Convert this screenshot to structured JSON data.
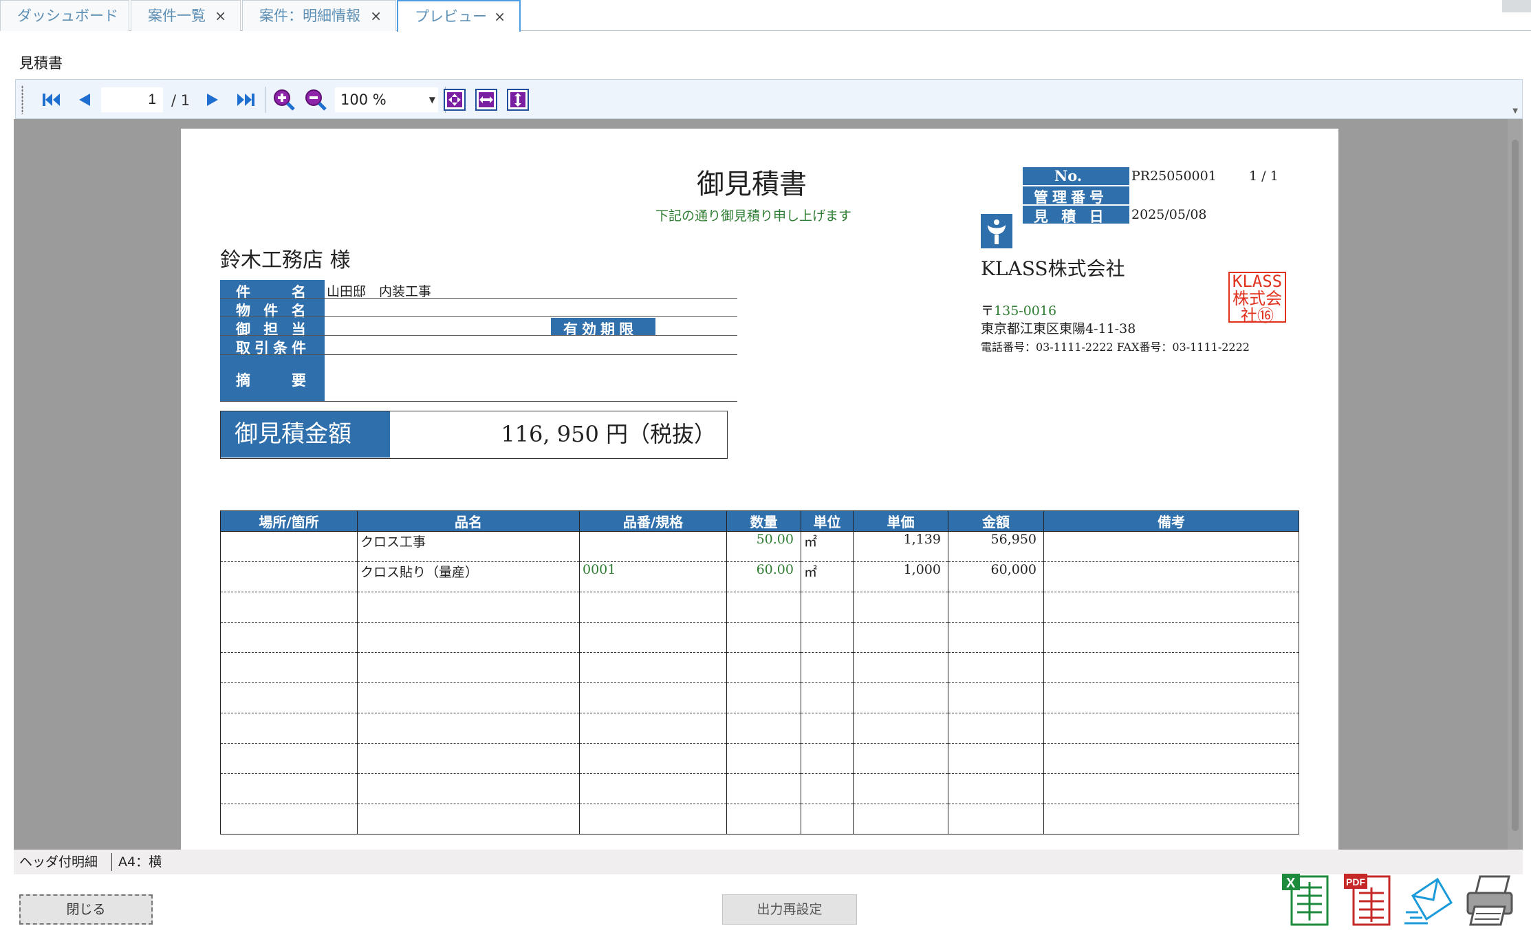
{
  "tabs": [
    {
      "label": "ダッシュボード",
      "closable": false,
      "active": false
    },
    {
      "label": "案件一覧",
      "closable": true,
      "active": false
    },
    {
      "label": "案件：明細情報",
      "closable": true,
      "active": false
    },
    {
      "label": "プレビュー",
      "closable": true,
      "active": true
    }
  ],
  "tab_close_glyph": "×",
  "doc_title": "見積書",
  "toolbar": {
    "page_current": "1",
    "page_total": "/ 1",
    "zoom": "100 %",
    "icons": [
      "first-page-icon",
      "prev-page-icon",
      "next-page-icon",
      "last-page-icon",
      "zoom-in-icon",
      "zoom-out-icon",
      "fit-page-icon",
      "fit-width-icon",
      "fit-height-icon"
    ]
  },
  "estimate": {
    "title": "御見積書",
    "subtitle": "下記の通り御見積り申し上げます",
    "no_label": "No.",
    "no_value": "PR25050001",
    "page_indicator": "1 / 1",
    "mgmt_label": "管理番号",
    "mgmt_value": "",
    "date_label": "見 積 日",
    "date_value": "2025/05/08",
    "customer": "鈴木工務店 様",
    "fields": {
      "subject_label": "件　　名",
      "subject_value": "山田邸　内装工事",
      "property_label": "物 件 名",
      "property_value": "",
      "contact_label": "御 担 当",
      "contact_value": "",
      "validity_label": "有効期限",
      "validity_value": "",
      "terms_label": "取引条件",
      "terms_value": "",
      "summary_label": "摘　　要",
      "summary_value": ""
    },
    "total_label": "御見積金額",
    "total_value": "116, 950 円（税抜）",
    "company": {
      "name": "KLASS株式会社",
      "postal_mark": "〒",
      "postal_code": "135-0016",
      "address": "東京都江東区東陽4-11-38",
      "phone": "電話番号：03-1111-2222 FAX番号：03-1111-2222",
      "seal_text": "KLASS株式会社",
      "seal_color": "#e0311f"
    },
    "columns": [
      "場所/箇所",
      "品名",
      "品番/規格",
      "数量",
      "単位",
      "単価",
      "金額",
      "備考"
    ],
    "rows": [
      {
        "place": "",
        "item": "クロス工事",
        "code": "",
        "qty": "50.00",
        "unit": "㎡",
        "price": "1,139",
        "amount": "56,950",
        "note": ""
      },
      {
        "place": "",
        "item": "クロス貼り（量産）",
        "code": "0001",
        "qty": "60.00",
        "unit": "㎡",
        "price": "1,000",
        "amount": "60,000",
        "note": ""
      },
      {
        "place": "",
        "item": "",
        "code": "",
        "qty": "",
        "unit": "",
        "price": "",
        "amount": "",
        "note": ""
      },
      {
        "place": "",
        "item": "",
        "code": "",
        "qty": "",
        "unit": "",
        "price": "",
        "amount": "",
        "note": ""
      },
      {
        "place": "",
        "item": "",
        "code": "",
        "qty": "",
        "unit": "",
        "price": "",
        "amount": "",
        "note": ""
      },
      {
        "place": "",
        "item": "",
        "code": "",
        "qty": "",
        "unit": "",
        "price": "",
        "amount": "",
        "note": ""
      },
      {
        "place": "",
        "item": "",
        "code": "",
        "qty": "",
        "unit": "",
        "price": "",
        "amount": "",
        "note": ""
      },
      {
        "place": "",
        "item": "",
        "code": "",
        "qty": "",
        "unit": "",
        "price": "",
        "amount": "",
        "note": ""
      },
      {
        "place": "",
        "item": "",
        "code": "",
        "qty": "",
        "unit": "",
        "price": "",
        "amount": "",
        "note": ""
      },
      {
        "place": "",
        "item": "",
        "code": "",
        "qty": "",
        "unit": "",
        "price": "",
        "amount": "",
        "note": ""
      }
    ]
  },
  "status": {
    "layout": "ヘッダ付明細",
    "paper": "A4：横"
  },
  "footer": {
    "close_label": "閉じる",
    "reset_label": "出力再設定",
    "outputs": [
      "excel-icon",
      "pdf-icon",
      "mail-icon",
      "printer-icon"
    ]
  },
  "colors": {
    "accent_blue": "#2e6fac",
    "tab_text": "#5e8fb4",
    "toolbar_icon": "#1f6fd1",
    "zoom_icon": "#7b1fa2",
    "excel_green": "#1e8a3c",
    "pdf_red": "#c62828",
    "mail_blue": "#1a9ad8"
  }
}
